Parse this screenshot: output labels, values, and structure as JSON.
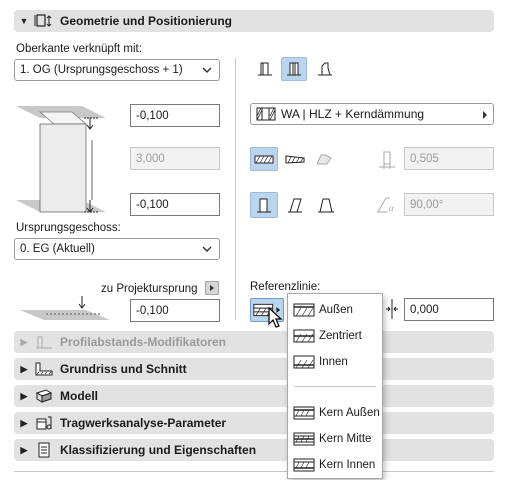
{
  "section_geometry": {
    "title": "Geometrie und Positionierung"
  },
  "top_link": {
    "label": "Oberkante verknüpft mit:",
    "value": "1. OG (Ursprungsgeschoss + 1)"
  },
  "offset_fields": {
    "top": "-0,100",
    "height": "3,000",
    "bottom": "-0,100"
  },
  "home_story": {
    "label": "Ursprungsgeschoss:",
    "value": "0. EG (Aktuell)"
  },
  "project_origin": {
    "label": "zu Projektursprung",
    "value": "-0,100"
  },
  "composite": {
    "value": "WA | HLZ + Kerndämmung"
  },
  "thickness": {
    "value": "0,505"
  },
  "angle": {
    "value": "90,00°"
  },
  "reference_line": {
    "label": "Referenzlinie:",
    "offset": "0,000"
  },
  "menu": {
    "items": [
      "Außen",
      "Zentriert",
      "Innen"
    ],
    "core_items": [
      "Kern Außen",
      "Kern Mitte",
      "Kern Innen"
    ]
  },
  "sections": [
    {
      "title": "Profilabstands-Modifikatoren",
      "disabled": true
    },
    {
      "title": "Grundriss und Schnitt",
      "disabled": false
    },
    {
      "title": "Modell",
      "disabled": false
    },
    {
      "title": "Tragwerksanalyse-Parameter",
      "disabled": false
    },
    {
      "title": "Klassifizierung und Eigenschaften",
      "disabled": false
    }
  ],
  "colors": {
    "section_bg": "#e2e2e2",
    "active_button": "#bcd5ee",
    "disabled_text": "#9a9a9a"
  }
}
